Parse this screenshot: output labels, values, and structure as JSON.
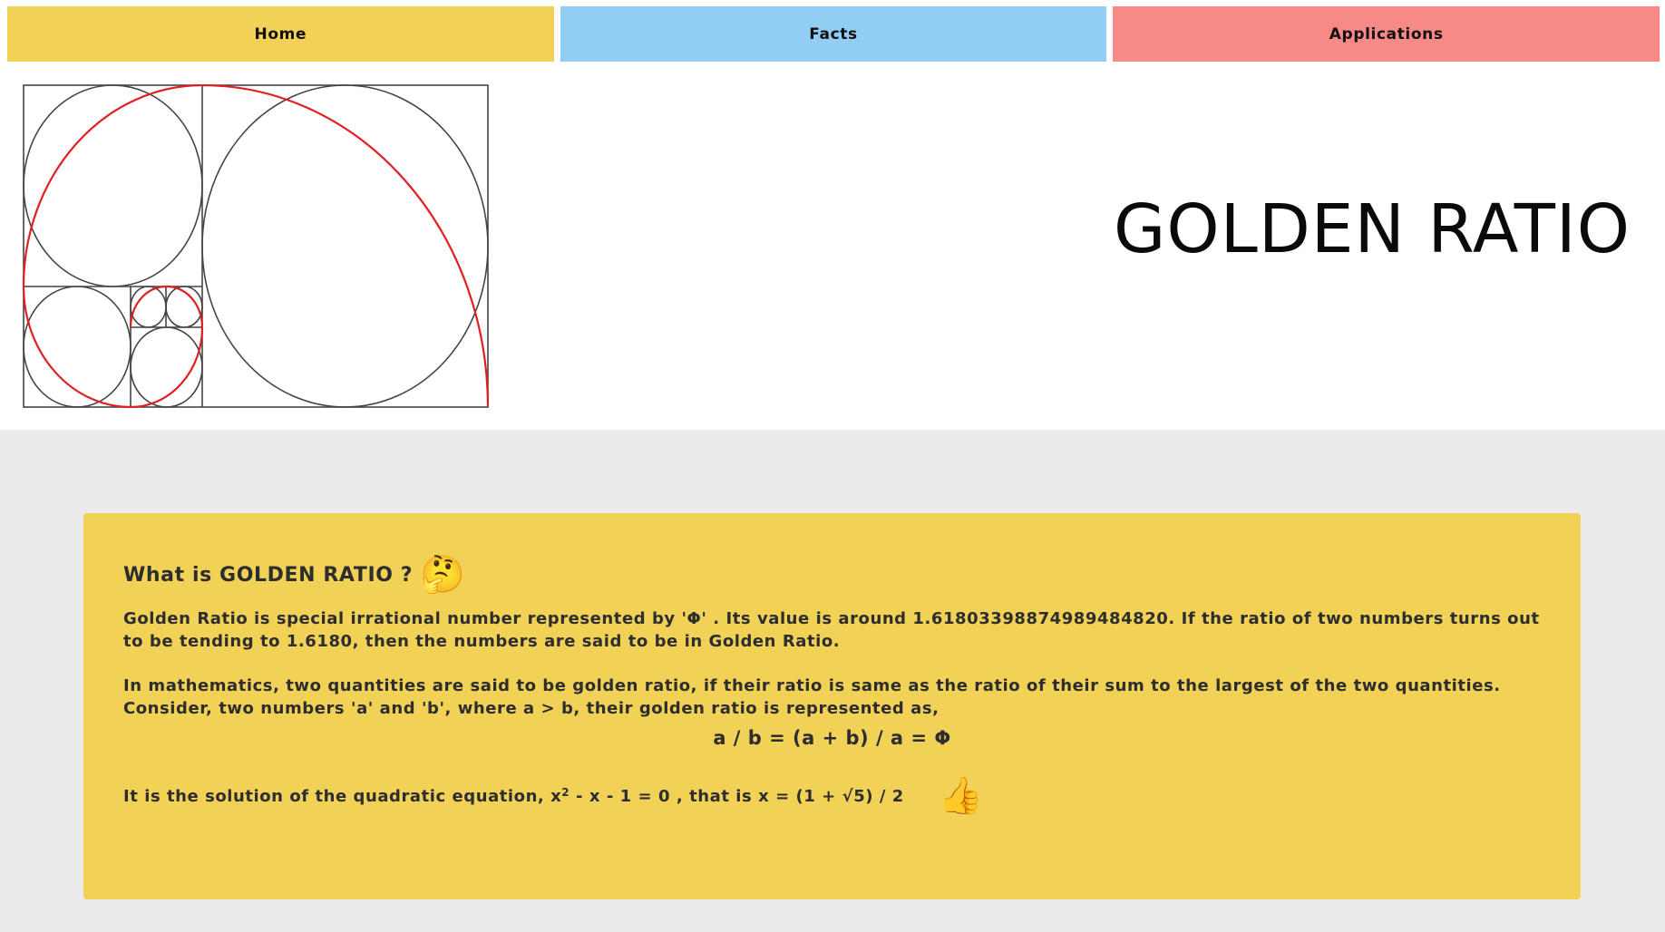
{
  "nav": {
    "home": "Home",
    "facts": "Facts",
    "applications": "Applications"
  },
  "header": {
    "title": "GOLDEN RATIO",
    "figure_icon": "golden-spiral-icon"
  },
  "card": {
    "heading": "What is GOLDEN RATIO ?",
    "heading_emoji": "🤔",
    "para1": "Golden Ratio is special irrational number represented by 'Φ' . Its value is around 1.61803398874989484820. If the ratio of two numbers turns out to be tending to 1.6180, then the numbers are said to be in Golden Ratio.",
    "para2": "In mathematics, two quantities are said to be golden ratio, if their ratio is same as the ratio of their sum to the largest of the two quantities. Consider, two numbers 'a' and 'b', where a > b, their golden ratio is represented as,",
    "equation": "a / b = (a + b) / a = Φ",
    "quad_before": "It is the solution of the quadratic equation, x",
    "quad_sup": "2",
    "quad_after": " - x - 1 = 0 , that is x = (1 + √5) / 2",
    "quad_emoji": "👍"
  },
  "colors": {
    "home": "#f1d257",
    "facts": "#92cdf4",
    "applications": "#f78986",
    "card": "#f1d257",
    "spiral": "#e02020",
    "background": "#ebebeb"
  }
}
